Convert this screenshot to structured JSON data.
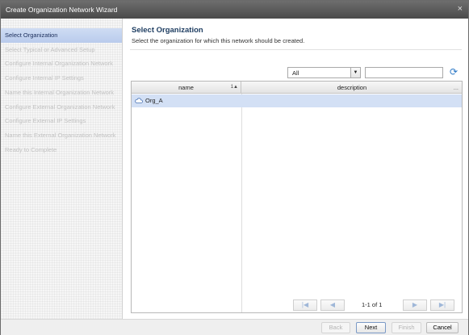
{
  "window": {
    "title": "Create Organization Network Wizard",
    "close_glyph": "×"
  },
  "sidebar": {
    "steps": [
      {
        "label": "Select Organization"
      },
      {
        "label": "Select Typical or Advanced Setup"
      },
      {
        "label": "Configure Internal Organization Network"
      },
      {
        "label": "Configure Internal IP Settings"
      },
      {
        "label": "Name this Internal Organization Network"
      },
      {
        "label": "Configure External Organization Network"
      },
      {
        "label": "Configure External IP Settings"
      },
      {
        "label": "Name this External Organization Network"
      },
      {
        "label": "Ready to Complete"
      }
    ],
    "active_index": 0
  },
  "main": {
    "title": "Select Organization",
    "subtitle": "Select the organization for which this network should be created."
  },
  "filter": {
    "selected": "All",
    "dropdown_glyph": "▼",
    "search_value": "",
    "refresh_glyph": "⟳"
  },
  "grid": {
    "columns": [
      {
        "label": "name",
        "sort_indicator": "1▲"
      },
      {
        "label": "description",
        "more": "..."
      }
    ],
    "rows": [
      {
        "name": "Org_A",
        "description": "",
        "icon": "cloud-icon"
      }
    ]
  },
  "pager": {
    "first": "|◀",
    "prev": "◀",
    "next": "▶",
    "last": "▶|",
    "status": "1-1 of 1"
  },
  "footer": {
    "back": "Back",
    "next": "Next",
    "finish": "Finish",
    "cancel": "Cancel"
  },
  "colors": {
    "active_step": "#c4d4f0",
    "selected_row": "#d3e0f5",
    "title_text": "#1f3e62",
    "refresh_icon": "#2b78c6"
  }
}
